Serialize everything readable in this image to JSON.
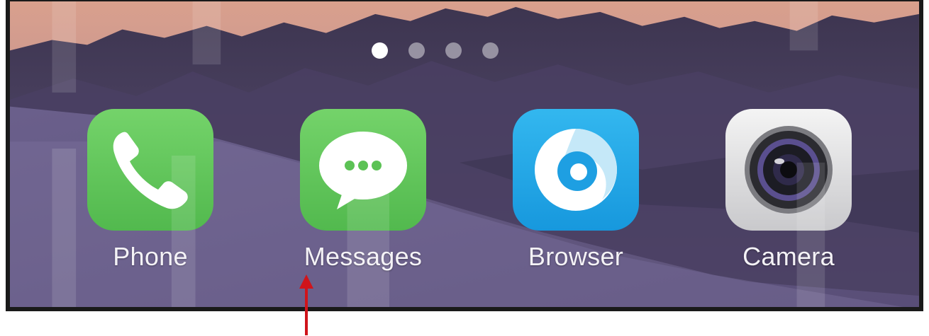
{
  "home_screen": {
    "page_indicator": {
      "count": 4,
      "active_index": 0
    },
    "apps": [
      {
        "label": "Phone",
        "icon": "phone-icon",
        "color": "#5cc255"
      },
      {
        "label": "Messages",
        "icon": "chat-bubble-icon",
        "color": "#5cc255"
      },
      {
        "label": "Browser",
        "icon": "browser-swirl-icon",
        "color": "#22a7e6"
      },
      {
        "label": "Camera",
        "icon": "camera-lens-icon",
        "color": "#e2e2e4"
      }
    ]
  },
  "annotation": {
    "pointer_target": "Messages",
    "arrow_color": "#d0141b"
  }
}
